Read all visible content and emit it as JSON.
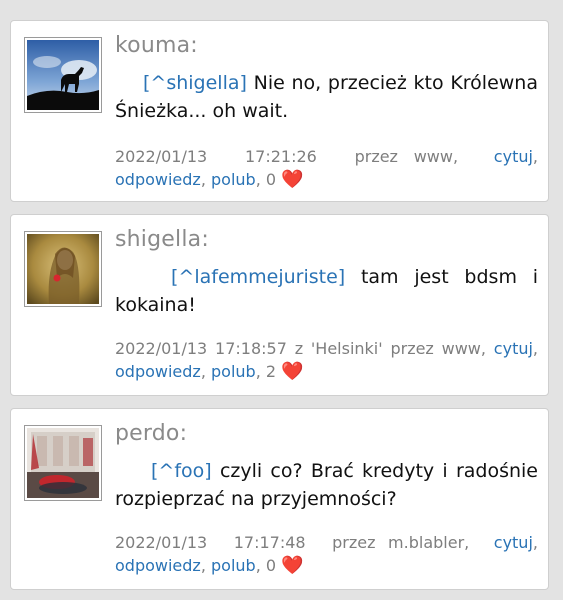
{
  "comments": [
    {
      "author": "kouma:",
      "reply_to": "[^shigella]",
      "text": " Nie no, przecież kto Królewna Śnieżka... oh wait.",
      "date": "2022/01/13",
      "time": "17:21:26",
      "via": "przez www,",
      "quote_label": "cytuj",
      "reply_label": "odpowiedz",
      "like_label": "polub",
      "likes": "0",
      "heart": "❤️"
    },
    {
      "author": "shigella:",
      "reply_to": "[^lafemmejuriste]",
      "text": " tam jest bdsm i kokaina!",
      "date": "2022/01/13",
      "time": "17:18:57",
      "via": "z 'Helsinki' przez www,",
      "quote_label": "cytuj",
      "reply_label": "odpowiedz",
      "like_label": "polub",
      "likes": "2",
      "heart": "❤️"
    },
    {
      "author": "perdo:",
      "reply_to": "[^foo]",
      "text": " czyli co? Brać kredyty i radośnie rozpieprzać na przyjemności?",
      "date": "2022/01/13",
      "time": "17:17:48",
      "via": "przez m.blabler,",
      "quote_label": "cytuj",
      "reply_label": "odpowiedz",
      "like_label": "polub",
      "likes": "0",
      "heart": "❤️"
    }
  ]
}
